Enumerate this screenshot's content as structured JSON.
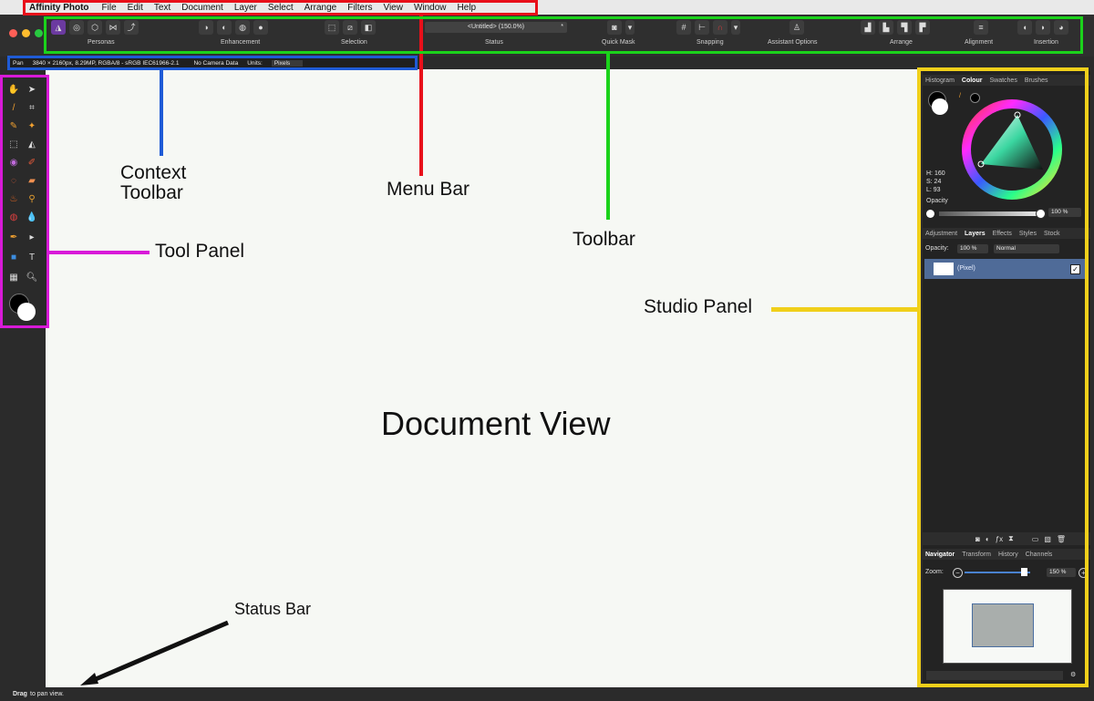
{
  "menubar": {
    "app_name": "Affinity Photo",
    "items": [
      "File",
      "Edit",
      "Text",
      "Document",
      "Layer",
      "Select",
      "Arrange",
      "Filters",
      "View",
      "Window",
      "Help"
    ]
  },
  "toolbar": {
    "labels": {
      "personas": "Personas",
      "enhancement": "Enhancement",
      "selection": "Selection",
      "status": "Status",
      "quick_mask": "Quick Mask",
      "snapping": "Snapping",
      "assistant_options": "Assistant Options",
      "arrange": "Arrange",
      "alignment": "Alignment",
      "insertion": "Insertion"
    },
    "status_doc": "<Untitled> (150.0%)",
    "status_modified": "*"
  },
  "context_toolbar": {
    "tool": "Pan",
    "doc_info": "3840 × 2160px, 8.29MP, RGBA/8 - sRGB IEC61966-2.1",
    "camera": "No Camera Data",
    "units_label": "Units:",
    "units_value": "Pixels"
  },
  "studio": {
    "top_tabs": [
      "Histogram",
      "Colour",
      "Swatches",
      "Brushes"
    ],
    "hsl": {
      "h": "H: 160",
      "s": "S: 24",
      "l": "L: 93"
    },
    "opacity_label": "Opacity",
    "opacity_value": "100 %",
    "layers_tabs": [
      "Adjustment",
      "Layers",
      "Effects",
      "Styles",
      "Stock"
    ],
    "layers_opacity_label": "Opacity:",
    "layers_opacity_value": "100 %",
    "blend_mode": "Normal",
    "layer_name": "(Pixel)",
    "nav_tabs": [
      "Navigator",
      "Transform",
      "History",
      "Channels"
    ],
    "zoom_label": "Zoom:",
    "zoom_value": "150 %"
  },
  "status_bar": {
    "bold": "Drag",
    "rest": " to pan view."
  },
  "annotations": {
    "context_toolbar": "Context",
    "context_toolbar_2": "Toolbar",
    "menu_bar": "Menu Bar",
    "toolbar": "Toolbar",
    "tool_panel": "Tool Panel",
    "studio_panel": "Studio Panel",
    "document_view": "Document View",
    "status_bar": "Status Bar"
  },
  "colors": {
    "menu_bar_box": "#e8101a",
    "toolbar_box": "#1bd21b",
    "context_box": "#1f5bd6",
    "tool_panel_box": "#d81ad8",
    "studio_box": "#f0cf1a",
    "status_arrow": "#111111"
  }
}
